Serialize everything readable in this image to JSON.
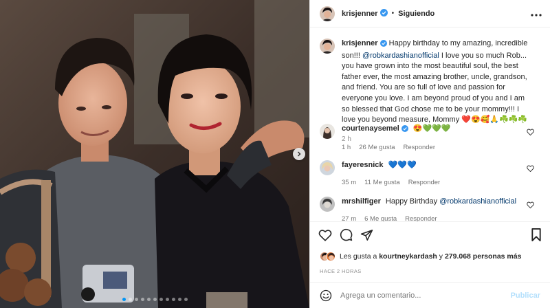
{
  "header": {
    "username": "krisjenner",
    "separator": "•",
    "follow_label": "Siguiendo",
    "more_icon": "more-horizontal-icon"
  },
  "caption": {
    "username": "krisjenner",
    "text": "Happy birthday to my amazing, incredible son!!! ",
    "mention": "@robkardashianofficial",
    "text_rest": " I love you so much Rob... you have grown into the most beautiful soul, the best father ever, the most amazing brother, uncle, grandson, and friend. You are so full of love and passion for everyone you love. I am beyond proud of you and I am so blessed that God chose me to be your mommy!!! I love you beyond measure, Mommy ",
    "emojis": "❤️😍🥰🙏☘️☘️☘️",
    "time": "2 h"
  },
  "comments": [
    {
      "username": "courtenaysemel",
      "text": "😍💚💚💚",
      "time": "1 h",
      "likes": "26 Me gusta",
      "reply": "Responder"
    },
    {
      "username": "fayeresnick",
      "text": "💙💙💙",
      "time": "35 m",
      "likes": "11 Me gusta",
      "reply": "Responder"
    },
    {
      "username": "mrshilfiger",
      "text": "Happy Birthday ",
      "mention": "@robkardashianofficial",
      "time": "27 m",
      "likes": "6 Me gusta",
      "reply": "Responder"
    }
  ],
  "likes": {
    "prefix": "Les gusta a ",
    "user": "kourtneykardash",
    "middle": " y ",
    "count": "279.068 personas más"
  },
  "ago": "HACE 2 HORAS",
  "add_comment": {
    "placeholder": "Agrega un comentario...",
    "publish": "Publicar"
  },
  "carousel": {
    "total": 11,
    "active": 0
  },
  "colors": {
    "link": "#00376b",
    "verified": "#3897f0",
    "accent": "#0095f6",
    "muted": "#8e8e8e",
    "publish_disabled": "#b2dffc"
  }
}
